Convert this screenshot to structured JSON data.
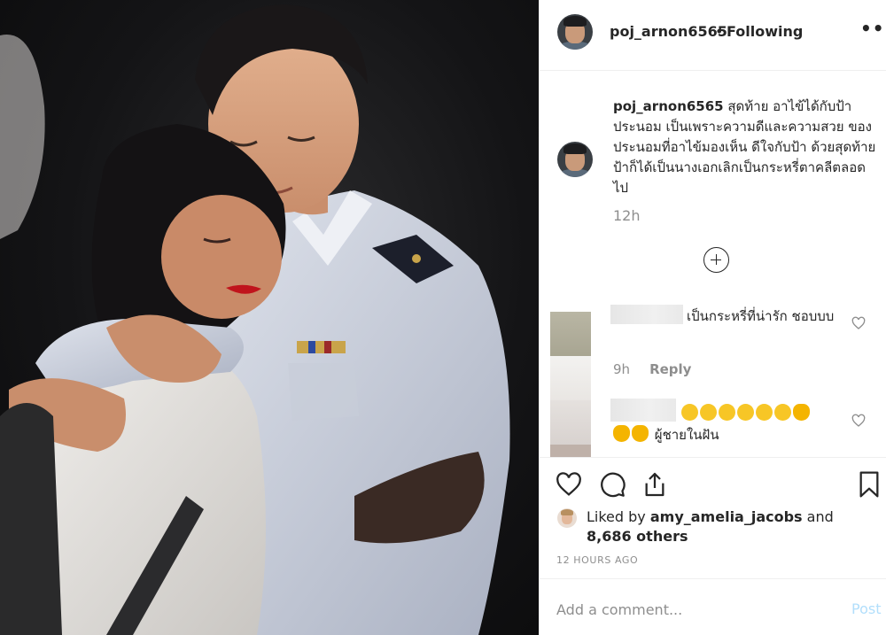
{
  "post": {
    "username": "poj_arnon6565",
    "dot": "•",
    "follow_status": "Following",
    "more": "•••",
    "caption_user": "poj_arnon6565",
    "caption_text": "สุดท้าย อาไข้ได้กับป้า ประนอม เป็นเพราะความดีและความสวย ของ ประนอมที่อาไข้มองเห็น ดีใจกับป้า ด้วยสุดท้ายป้าก็ได้เป็นนางเอกเลิกเป็นกระหรี่ตาคลีตลอดไป",
    "caption_time": "12h"
  },
  "comments": [
    {
      "text": "เป็นกระหรี่ที่น่ารัก ชอบบบ",
      "time": "9h",
      "reply": "Reply"
    },
    {
      "text_tail": "ผู้ชายในฝัน",
      "emoji_row1": [
        "grin",
        "grin",
        "grin",
        "laugh",
        "laugh",
        "laugh",
        "clap"
      ],
      "emoji_row2": [
        "clap",
        "clap"
      ]
    }
  ],
  "likes": {
    "prefix": "Liked by",
    "user": "amy_amelia_jacobs",
    "and": "and",
    "others": "8,686 others"
  },
  "post_time": "12 HOURS AGO",
  "add_comment": {
    "placeholder": "Add a comment...",
    "post_label": "Post"
  },
  "icons": {
    "heart": "heart-icon",
    "comment": "comment-bubble-icon",
    "share": "share-icon",
    "save": "bookmark-icon",
    "load_more": "plus-circle-icon"
  },
  "colors": {
    "text": "#262626",
    "muted": "#8e8e8e",
    "post_disabled": "#b2dffc",
    "border": "#efefef"
  }
}
